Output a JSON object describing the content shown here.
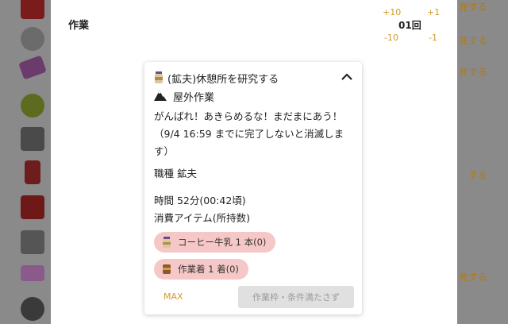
{
  "sheet": {
    "title": "作業",
    "counter": {
      "plus10": "+10",
      "plus1": "+1",
      "value": "01回",
      "minus10": "-10",
      "minus1": "-1"
    }
  },
  "background": {
    "right_labels": [
      "充する",
      "充する",
      "充する",
      "する",
      "充する"
    ],
    "icons": [
      "red-item-icon",
      "helmet-icon",
      "purple-card-icon",
      "green-plant-icon",
      "furnace-icon",
      "red-bottle-icon",
      "red-item-icon",
      "stone-icon",
      "purple-bar-icon",
      "disc-icon"
    ]
  },
  "card": {
    "title": "(鉱夫)休憩所を研究する",
    "location": "屋外作業",
    "description": "がんばれ！あきらめるな！まだまにあう！（9/4 16:59 までに完了しないと消滅します）",
    "job": "職種 鉱夫",
    "time": "時間 52分(00:42頃)",
    "consume_label": "消費アイテム(所持数)",
    "items": [
      {
        "icon": "coffee-milk-icon",
        "label": "コーヒー牛乳 1 本(0)"
      },
      {
        "icon": "work-clothes-icon",
        "label": "作業着 1 着(0)"
      }
    ],
    "max_label": "MAX",
    "slot_button_label": "作業枠・条件満たさず"
  },
  "colors": {
    "accent": "#d39a2c",
    "chip": "#f6c7c7",
    "disabled": "#e0e0e0"
  }
}
